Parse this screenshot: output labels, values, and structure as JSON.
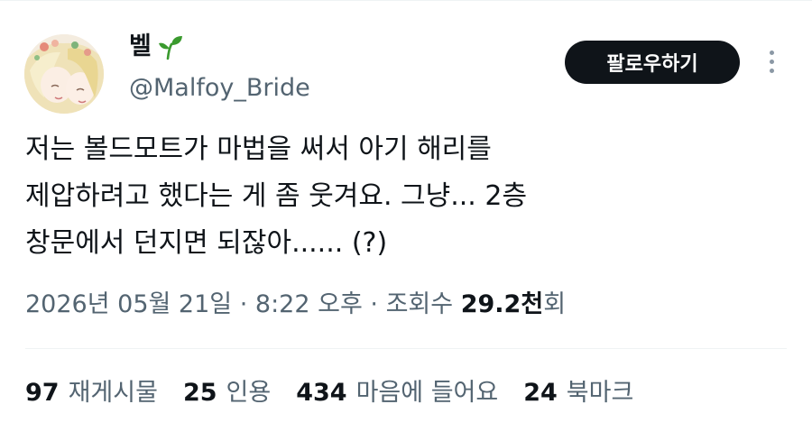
{
  "author": {
    "display_name": "벨",
    "badge_icon": "sprout-icon",
    "handle": "@Malfoy_Bride"
  },
  "follow_button": {
    "label": "팔로우하기"
  },
  "more_button": {
    "icon": "more-vertical-icon"
  },
  "tweet": {
    "text": "저는 볼드모트가 마법을 써서 아기 해리를\n제압하려고 했다는 게 좀 웃겨요. 그냥... 2층\n창문에서 던지면 되잖아...... (?)"
  },
  "meta": {
    "date": "2026년 05월 21일",
    "separator": "·",
    "time": "8:22 오후",
    "views_label": "조회수",
    "views_count": "29.2천",
    "views_suffix": "회"
  },
  "stats": [
    {
      "value": "97",
      "label": "재게시물"
    },
    {
      "value": "25",
      "label": "인용"
    },
    {
      "value": "434",
      "label": "마음에 들어요"
    },
    {
      "value": "24",
      "label": "북마크"
    }
  ],
  "colors": {
    "text": "#0f1419",
    "secondary": "#536471",
    "divider": "#eff3f4",
    "button_bg": "#0f1419",
    "sprout": "#3a9a2e"
  }
}
